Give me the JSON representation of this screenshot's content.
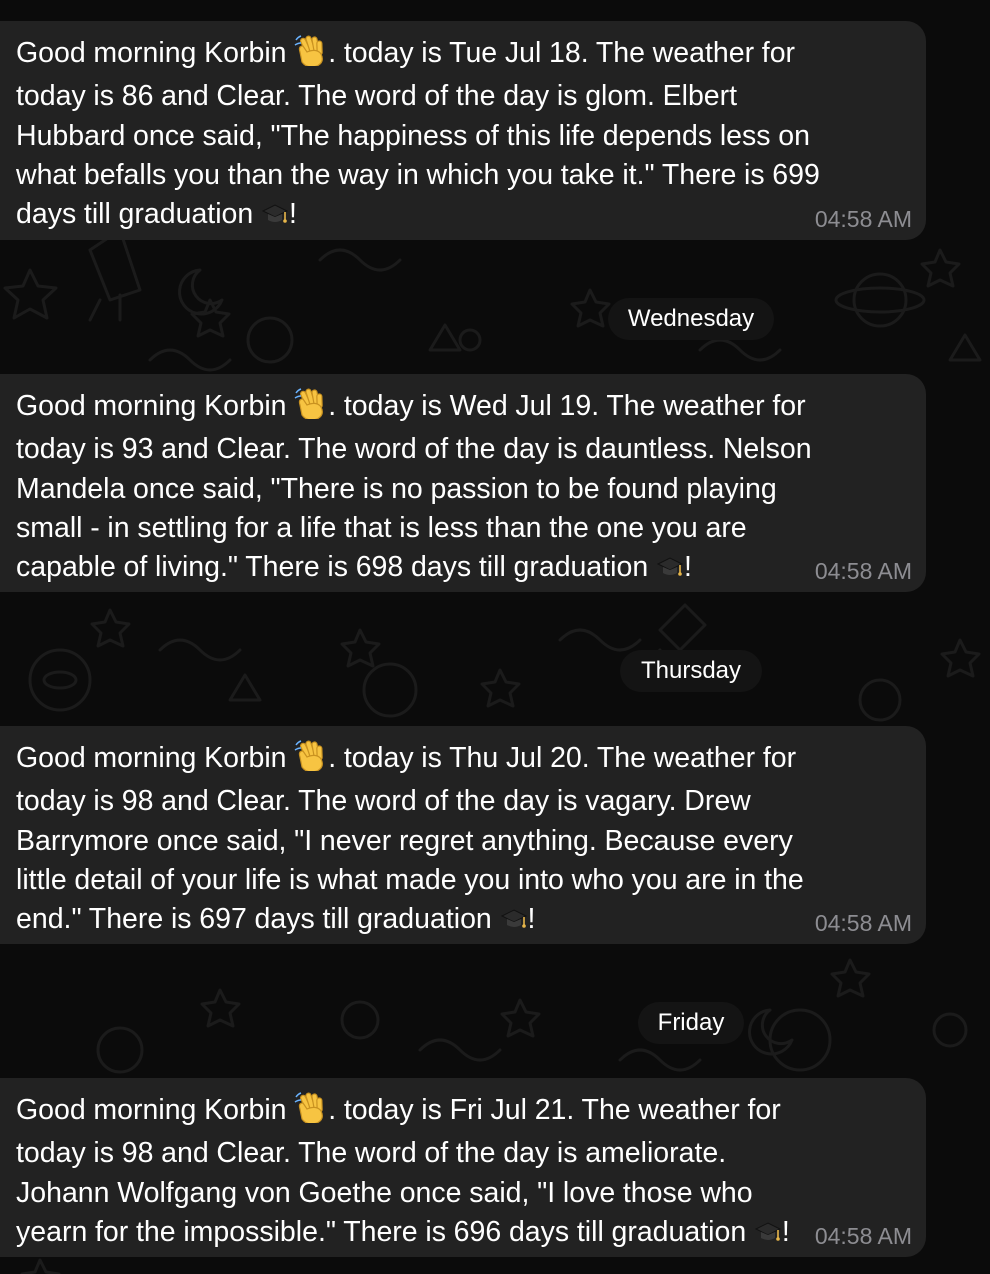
{
  "messages": [
    {
      "text_before_wave": "Good morning Korbin ",
      "text_after_wave": ". today is Tue Jul 18. The weather for today is 86 and Clear. The word of the day is glom. Elbert Hubbard once said, \"The happiness of this life depends less on what befalls you than the way in which you take it.\" There is 699 days till graduation ",
      "text_end": "!",
      "time": "04:58 AM"
    },
    {
      "text_before_wave": "Good morning Korbin ",
      "text_after_wave": ". today is Wed Jul 19. The weather for today is 93 and Clear. The word of the day is dauntless. Nelson Mandela once said, \"There is no passion to be found playing small - in settling for a life that is less than the one you are capable of living.\" There is 698 days till graduation ",
      "text_end": "!",
      "time": "04:58 AM"
    },
    {
      "text_before_wave": "Good morning Korbin ",
      "text_after_wave": ". today is Thu Jul 20. The weather for today is 98 and Clear. The word of the day is vagary. Drew Barrymore once said, \"I never regret anything. Because every little detail of your life is what made you into who you are in the end.\" There is 697 days till graduation ",
      "text_end": "!",
      "time": "04:58 AM"
    },
    {
      "text_before_wave": "Good morning Korbin ",
      "text_after_wave": ". today is Fri Jul 21. The weather for today is 98 and Clear. The word of the day is ameliorate. Johann Wolfgang von Goethe once said, \"I love those who yearn for the impossible.\" There is 696 days till graduation ",
      "text_end": "!",
      "time": "04:58 AM"
    }
  ],
  "day_separators": [
    "Wednesday",
    "Thursday",
    "Friday"
  ],
  "icons": {
    "wave": "waving-hand-icon",
    "graduation": "graduation-cap-icon"
  },
  "colors": {
    "background": "#0b0b0b",
    "bubble": "#222222",
    "text": "#ffffff",
    "timestamp": "#8d8d92",
    "pill": "#141414"
  }
}
